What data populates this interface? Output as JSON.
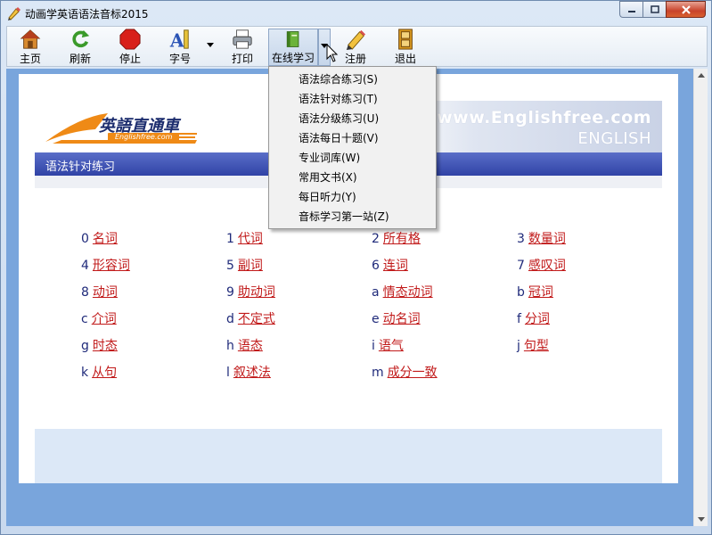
{
  "window": {
    "title": "动画学英语语法音标2015"
  },
  "toolbar": {
    "items": [
      {
        "label": "主页",
        "icon": "home-icon"
      },
      {
        "label": "刷新",
        "icon": "refresh-icon"
      },
      {
        "label": "停止",
        "icon": "stop-icon"
      },
      {
        "label": "字号",
        "icon": "font-size-icon"
      },
      {
        "label": "打印",
        "icon": "printer-icon"
      },
      {
        "label": "在线学习",
        "icon": "book-icon"
      },
      {
        "label": "注册",
        "icon": "pencil-icon"
      },
      {
        "label": "退出",
        "icon": "exit-icon"
      }
    ]
  },
  "banner": {
    "logo_text": "英語直通車",
    "logo_sub": "Englishfree.com",
    "site_url": "www.Englishfree.com",
    "site_eng": "ENGLISH"
  },
  "section": {
    "title": "语法针对练习"
  },
  "topics": [
    {
      "code": "0",
      "label": "名词"
    },
    {
      "code": "1",
      "label": "代词"
    },
    {
      "code": "2",
      "label": "所有格"
    },
    {
      "code": "3",
      "label": "数量词"
    },
    {
      "code": "4",
      "label": "形容词"
    },
    {
      "code": "5",
      "label": "副词"
    },
    {
      "code": "6",
      "label": "连词"
    },
    {
      "code": "7",
      "label": "感叹词"
    },
    {
      "code": "8",
      "label": "动词"
    },
    {
      "code": "9",
      "label": "助动词"
    },
    {
      "code": "a",
      "label": "情态动词"
    },
    {
      "code": "b",
      "label": "冠词"
    },
    {
      "code": "c",
      "label": "介词"
    },
    {
      "code": "d",
      "label": "不定式"
    },
    {
      "code": "e",
      "label": "动名词"
    },
    {
      "code": "f",
      "label": "分词"
    },
    {
      "code": "g",
      "label": "时态"
    },
    {
      "code": "h",
      "label": "语态"
    },
    {
      "code": "i",
      "label": "语气"
    },
    {
      "code": "j",
      "label": "句型"
    },
    {
      "code": "k",
      "label": "从句"
    },
    {
      "code": "l",
      "label": "叙述法"
    },
    {
      "code": "m",
      "label": "成分一致"
    }
  ],
  "menu": {
    "items": [
      "语法综合练习(S)",
      "语法针对练习(T)",
      "语法分级练习(U)",
      "语法每日十题(V)",
      "专业词库(W)",
      "常用文书(X)",
      "每日听力(Y)",
      "音标学习第一站(Z)"
    ]
  },
  "colors": {
    "accent": "#3043a6",
    "link": "#c11a1a",
    "code": "#1f2a7a"
  }
}
